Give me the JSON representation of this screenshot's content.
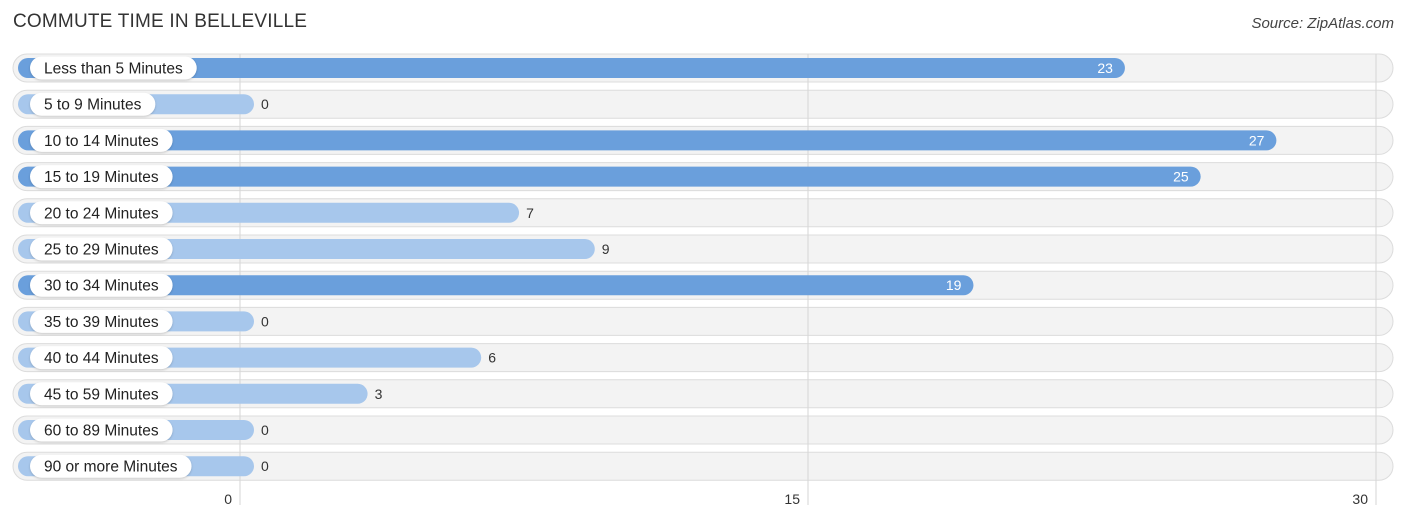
{
  "header": {
    "title": "COMMUTE TIME IN BELLEVILLE",
    "source": "Source: ZipAtlas.com"
  },
  "colors": {
    "bar_strong": "#6a9fdc",
    "bar_light": "#a7c7ec",
    "row_background": "#f3f3f3"
  },
  "chart_data": {
    "type": "bar",
    "orientation": "horizontal",
    "title": "COMMUTE TIME IN BELLEVILLE",
    "xlabel": "",
    "ylabel": "",
    "categories": [
      "Less than 5 Minutes",
      "5 to 9 Minutes",
      "10 to 14 Minutes",
      "15 to 19 Minutes",
      "20 to 24 Minutes",
      "25 to 29 Minutes",
      "30 to 34 Minutes",
      "35 to 39 Minutes",
      "40 to 44 Minutes",
      "45 to 59 Minutes",
      "60 to 89 Minutes",
      "90 or more Minutes"
    ],
    "values": [
      23,
      0,
      27,
      25,
      7,
      9,
      19,
      0,
      6,
      3,
      0,
      0
    ],
    "xlim": [
      0,
      30
    ],
    "xticks": [
      0,
      15,
      30
    ],
    "xtick_labels": [
      "0",
      "15",
      "30"
    ],
    "grid": true,
    "legend": "none"
  }
}
